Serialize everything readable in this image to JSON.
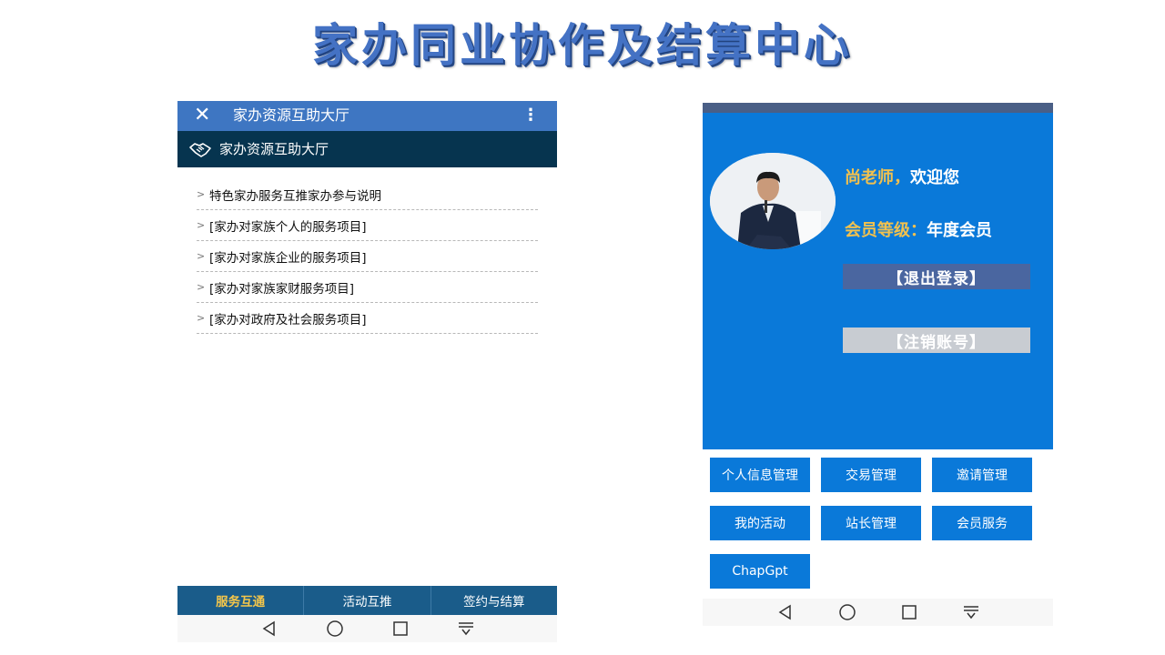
{
  "slide": {
    "title": "家办同业协作及结算中心"
  },
  "left_phone": {
    "topbar_title": "家办资源互助大厅",
    "header_title": "家办资源互助大厅",
    "list_items": [
      "特色家办服务互推家办参与说明",
      "[家办对家族个人的服务项目]",
      "[家办对家族企业的服务项目]",
      "[家办对家族家财服务项目]",
      "[家办对政府及社会服务项目]"
    ],
    "tabs": [
      "服务互通",
      "活动互推",
      "签约与结算"
    ],
    "active_tab": "服务互通"
  },
  "right_phone": {
    "greeting_name": "尚老师，",
    "greeting_welcome": "欢迎您",
    "level_label": "会员等级：",
    "level_value": "年度会员",
    "logout_label": "【退出登录】",
    "cancel_account_label": "【注销账号】",
    "tiles": [
      "个人信息管理",
      "交易管理",
      "邀请管理",
      "我的活动",
      "站长管理",
      "会员服务",
      "ChapGpt"
    ]
  },
  "colors": {
    "title_blue": "#4472c4",
    "topbar_blue": "#3e76c2",
    "header_navy": "#06344f",
    "tabbar_blue": "#1a5c8a",
    "active_tab_gold": "#f5c64a",
    "panel_blue": "#0a79d9",
    "greeting_gold": "#f2c14e",
    "logout_bg": "#4a66a0",
    "cancel_bg": "#c8ccd2"
  },
  "icons": {
    "close": "close-icon",
    "more": "more-vertical-icon",
    "header": "handshake-icon",
    "nav": [
      "back-triangle-icon",
      "home-circle-icon",
      "recents-square-icon",
      "notification-pull-icon"
    ]
  }
}
